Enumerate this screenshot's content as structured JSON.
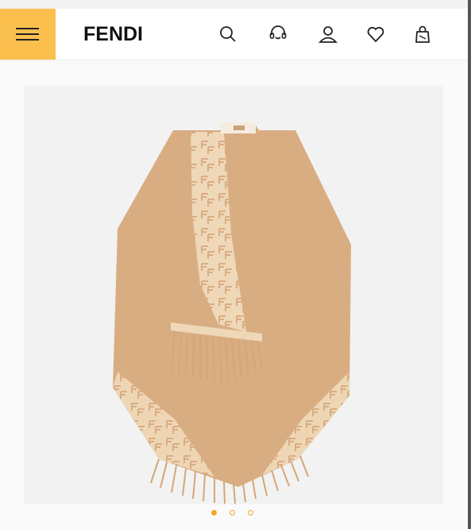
{
  "header": {
    "brand": "FENDI",
    "accent_color": "#fbbf4e",
    "icons": [
      "menu-icon",
      "search-icon",
      "customer-service-icon",
      "user-icon",
      "heart-icon",
      "bag-icon"
    ]
  },
  "product": {
    "image_colors": {
      "camel": "#d9ad82",
      "cream": "#efd8b8"
    }
  },
  "carousel": {
    "slide_count": 3,
    "active_index": 0,
    "dot_color": "#f5a623"
  }
}
